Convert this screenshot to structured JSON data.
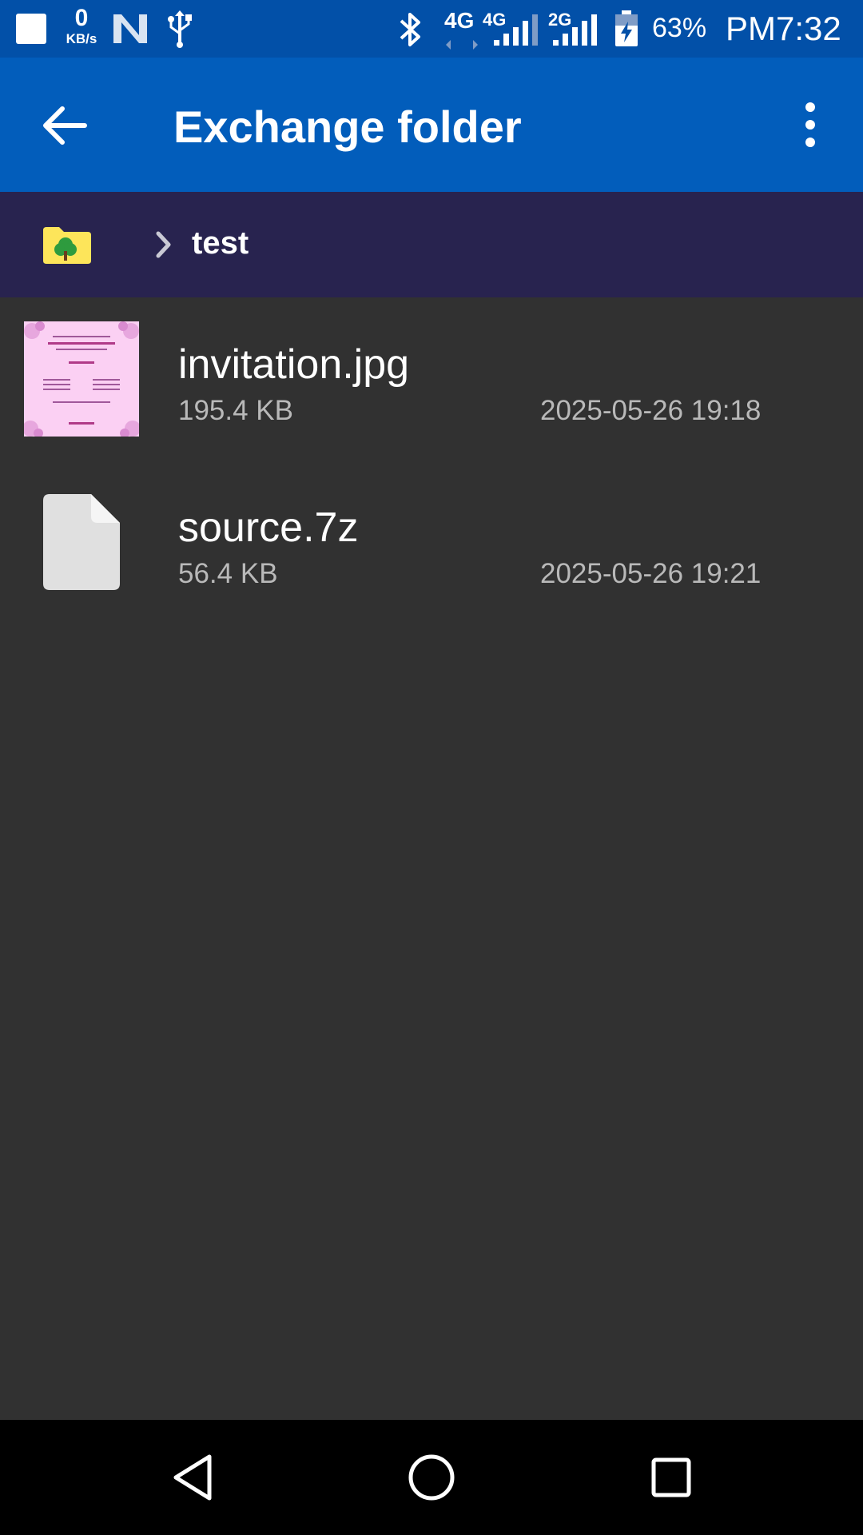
{
  "status_bar": {
    "net_speed_value": "0",
    "net_speed_unit": "KB/s",
    "network_labels": [
      "4G",
      "4G",
      "2G"
    ],
    "battery_percent": "63%",
    "time": "PM7:32",
    "icons": [
      "notification-square-icon",
      "n-logo-icon",
      "usb-icon",
      "bluetooth-icon",
      "signal-icon",
      "battery-charging-icon"
    ]
  },
  "app_bar": {
    "title": "Exchange folder",
    "back_icon": "arrow-left-icon",
    "menu_icon": "more-vert-icon",
    "color": "#025dbb"
  },
  "path_bar": {
    "root_icon": "folder-tree-icon",
    "separator_icon": "chevron-right-icon",
    "current": "test",
    "color": "#28234f"
  },
  "files": [
    {
      "name": "invitation.jpg",
      "size": "195.4 KB",
      "modified": "2025-05-26 19:18",
      "icon": "image-thumbnail"
    },
    {
      "name": "source.7z",
      "size": "56.4 KB",
      "modified": "2025-05-26 19:21",
      "icon": "generic-file-icon"
    }
  ],
  "nav_bar": {
    "icons": [
      "nav-back-icon",
      "nav-home-icon",
      "nav-recents-icon"
    ]
  }
}
